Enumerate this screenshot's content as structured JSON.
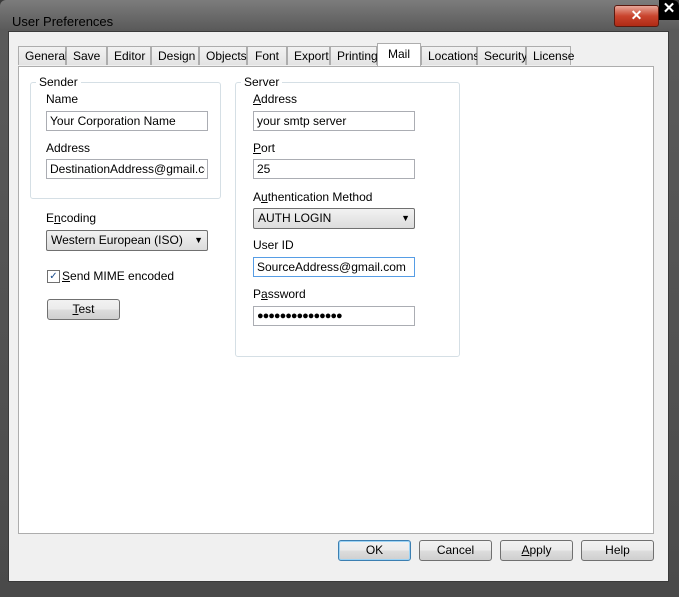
{
  "window": {
    "title": "User Preferences",
    "close_symbol": "✕",
    "corner_close_symbol": "✕"
  },
  "tabs": [
    {
      "label": "General"
    },
    {
      "label": "Save"
    },
    {
      "label": "Editor"
    },
    {
      "label": "Design"
    },
    {
      "label": "Objects"
    },
    {
      "label": "Font"
    },
    {
      "label": "Export"
    },
    {
      "label": "Printing"
    },
    {
      "label": "Mail",
      "active": true
    },
    {
      "label": "Locations"
    },
    {
      "label": "Security"
    },
    {
      "label": "License"
    }
  ],
  "sender": {
    "legend": "Sender",
    "name_label": "Name",
    "name_value": "Your Corporation Name",
    "address_label": "Address",
    "address_value": "DestinationAddress@gmail.com"
  },
  "encoding": {
    "label_pre": "E",
    "label_u": "n",
    "label_post": "coding",
    "selected": "Western European (ISO)"
  },
  "mime": {
    "checked": true,
    "check_glyph": "✓",
    "label_u": "S",
    "label_post": "end MIME encoded"
  },
  "test_button": {
    "label_u": "T",
    "label_post": "est"
  },
  "server": {
    "legend": "Server",
    "address_label_u": "A",
    "address_label_post": "ddress",
    "address_value": "your smtp server",
    "port_label_u": "P",
    "port_label_post": "ort",
    "port_value": "25",
    "auth_label_pre": "A",
    "auth_label_u": "u",
    "auth_label_post": "thentication Method",
    "auth_selected": "AUTH LOGIN",
    "userid_label": "User ID",
    "userid_value": "SourceAddress@gmail.com",
    "password_label_pre": "P",
    "password_label_u": "a",
    "password_label_post": "ssword",
    "password_mask": "●●●●●●●●●●●●●●●"
  },
  "dropdown_arrow": "▼",
  "buttons": {
    "ok": "OK",
    "cancel": "Cancel",
    "apply_u": "A",
    "apply_post": "pply",
    "help": "Help"
  }
}
